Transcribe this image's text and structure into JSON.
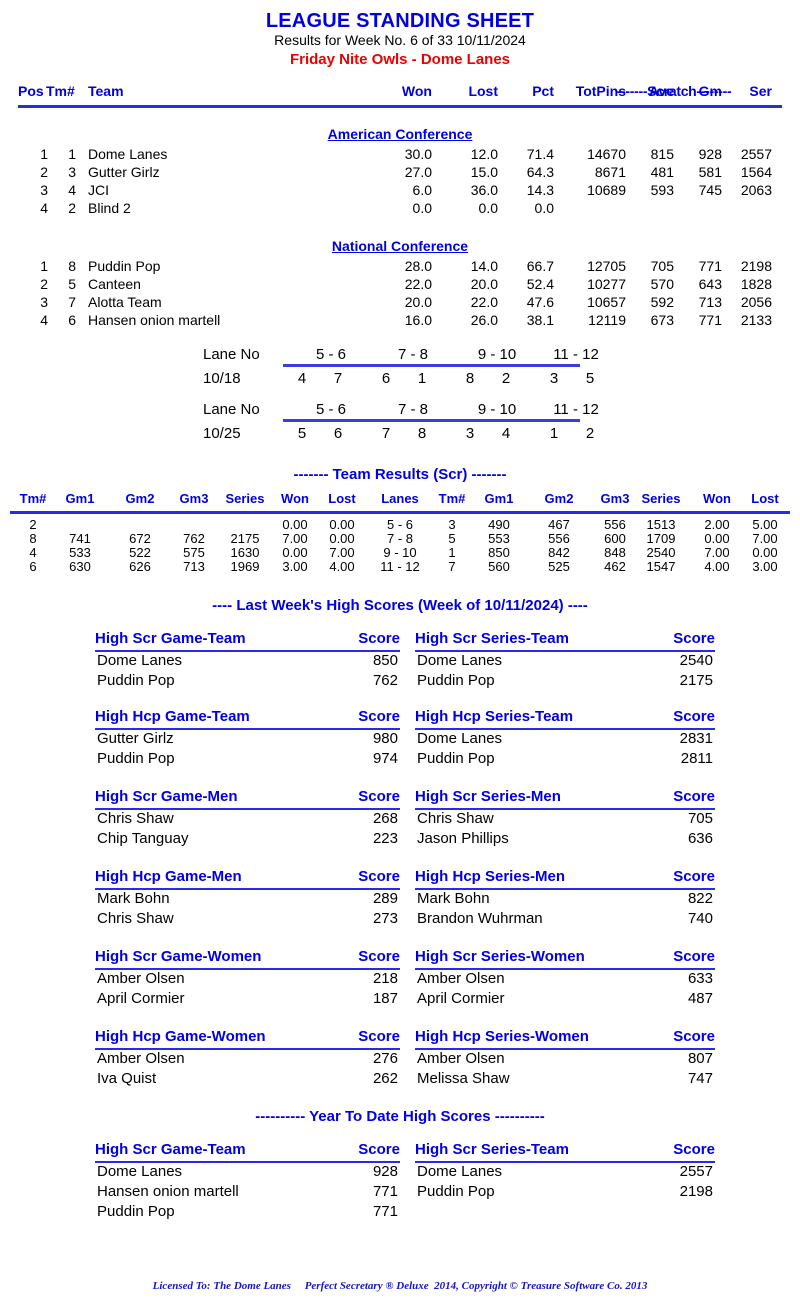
{
  "header": {
    "title": "LEAGUE STANDING SHEET",
    "subtitle": "Results for Week No. 6 of 33    10/11/2024",
    "league": "Friday Nite Owls - Dome Lanes"
  },
  "standings": {
    "scratch_label": "-------Scratch--------",
    "columns": [
      "Pos",
      "Tm#",
      "Team",
      "Won",
      "Lost",
      "Pct",
      "TotPins",
      "Ave",
      "Gm",
      "Ser"
    ],
    "conferences": [
      {
        "name": "American Conference",
        "rows": [
          {
            "pos": "1",
            "tm": "1",
            "team": "Dome Lanes",
            "won": "30.0",
            "lost": "12.0",
            "pct": "71.4",
            "totpins": "14670",
            "ave": "815",
            "gm": "928",
            "ser": "2557"
          },
          {
            "pos": "2",
            "tm": "3",
            "team": "Gutter Girlz",
            "won": "27.0",
            "lost": "15.0",
            "pct": "64.3",
            "totpins": "8671",
            "ave": "481",
            "gm": "581",
            "ser": "1564"
          },
          {
            "pos": "3",
            "tm": "4",
            "team": "JCI",
            "won": "6.0",
            "lost": "36.0",
            "pct": "14.3",
            "totpins": "10689",
            "ave": "593",
            "gm": "745",
            "ser": "2063"
          },
          {
            "pos": "4",
            "tm": "2",
            "team": "Blind 2",
            "won": "0.0",
            "lost": "0.0",
            "pct": "0.0",
            "totpins": "",
            "ave": "",
            "gm": "",
            "ser": ""
          }
        ]
      },
      {
        "name": "National Conference",
        "rows": [
          {
            "pos": "1",
            "tm": "8",
            "team": "Puddin Pop",
            "won": "28.0",
            "lost": "14.0",
            "pct": "66.7",
            "totpins": "12705",
            "ave": "705",
            "gm": "771",
            "ser": "2198"
          },
          {
            "pos": "2",
            "tm": "5",
            "team": "Canteen",
            "won": "22.0",
            "lost": "20.0",
            "pct": "52.4",
            "totpins": "10277",
            "ave": "570",
            "gm": "643",
            "ser": "1828"
          },
          {
            "pos": "3",
            "tm": "7",
            "team": "Alotta Team",
            "won": "20.0",
            "lost": "22.0",
            "pct": "47.6",
            "totpins": "10657",
            "ave": "592",
            "gm": "713",
            "ser": "2056"
          },
          {
            "pos": "4",
            "tm": "6",
            "team": "Hansen onion martell",
            "won": "16.0",
            "lost": "26.0",
            "pct": "38.1",
            "totpins": "12119",
            "ave": "673",
            "gm": "771",
            "ser": "2133"
          }
        ]
      }
    ]
  },
  "lane_schedules": [
    {
      "label": "Lane No",
      "date": "10/18",
      "lanes": [
        "5 -  6",
        "7 -  8",
        "9 - 10",
        "11 - 12"
      ],
      "teams": [
        "4",
        "7",
        "6",
        "1",
        "8",
        "2",
        "3",
        "5"
      ]
    },
    {
      "label": "Lane No",
      "date": "10/25",
      "lanes": [
        "5 -  6",
        "7 -  8",
        "9 - 10",
        "11 - 12"
      ],
      "teams": [
        "5",
        "6",
        "7",
        "8",
        "3",
        "4",
        "1",
        "2"
      ]
    }
  ],
  "team_results": {
    "title": "------- Team Results (Scr) -------",
    "columns": [
      "Tm#",
      "Gm1",
      "Gm2",
      "Gm3",
      "Series",
      "Won",
      "Lost",
      "Lanes",
      "Tm#",
      "Gm1",
      "Gm2",
      "Gm3",
      "Series",
      "Won",
      "Lost"
    ],
    "rows": [
      {
        "a_tm": "2",
        "a_gm1": "",
        "a_gm2": "",
        "a_gm3": "",
        "a_series": "",
        "a_won": "0.00",
        "a_lost": "0.00",
        "lanes": "5  -  6",
        "b_tm": "3",
        "b_gm1": "490",
        "b_gm2": "467",
        "b_gm3": "556",
        "b_series": "1513",
        "b_won": "2.00",
        "b_lost": "5.00"
      },
      {
        "a_tm": "8",
        "a_gm1": "741",
        "a_gm2": "672",
        "a_gm3": "762",
        "a_series": "2175",
        "a_won": "7.00",
        "a_lost": "0.00",
        "lanes": "7  -  8",
        "b_tm": "5",
        "b_gm1": "553",
        "b_gm2": "556",
        "b_gm3": "600",
        "b_series": "1709",
        "b_won": "0.00",
        "b_lost": "7.00"
      },
      {
        "a_tm": "4",
        "a_gm1": "533",
        "a_gm2": "522",
        "a_gm3": "575",
        "a_series": "1630",
        "a_won": "0.00",
        "a_lost": "7.00",
        "lanes": "9  - 10",
        "b_tm": "1",
        "b_gm1": "850",
        "b_gm2": "842",
        "b_gm3": "848",
        "b_series": "2540",
        "b_won": "7.00",
        "b_lost": "0.00"
      },
      {
        "a_tm": "6",
        "a_gm1": "630",
        "a_gm2": "626",
        "a_gm3": "713",
        "a_series": "1969",
        "a_won": "3.00",
        "a_lost": "4.00",
        "lanes": "11 - 12",
        "b_tm": "7",
        "b_gm1": "560",
        "b_gm2": "525",
        "b_gm3": "462",
        "b_series": "1547",
        "b_won": "4.00",
        "b_lost": "3.00"
      }
    ]
  },
  "last_week": {
    "heading": "----  Last Week's High Scores   (Week of 10/11/2024)  ----",
    "score_header": "Score",
    "blocks": [
      {
        "left": {
          "category": "High Scr Game-Team",
          "rows": [
            {
              "name": "Dome Lanes",
              "score": "850"
            },
            {
              "name": "Puddin Pop",
              "score": "762"
            }
          ]
        },
        "right": {
          "category": "High Scr Series-Team",
          "rows": [
            {
              "name": "Dome Lanes",
              "score": "2540"
            },
            {
              "name": "Puddin Pop",
              "score": "2175"
            }
          ]
        }
      },
      {
        "left": {
          "category": "High Hcp Game-Team",
          "rows": [
            {
              "name": "Gutter Girlz",
              "score": "980"
            },
            {
              "name": "Puddin Pop",
              "score": "974"
            }
          ]
        },
        "right": {
          "category": "High Hcp Series-Team",
          "rows": [
            {
              "name": "Dome Lanes",
              "score": "2831"
            },
            {
              "name": "Puddin Pop",
              "score": "2811"
            }
          ]
        }
      },
      {
        "left": {
          "category": "High Scr Game-Men",
          "rows": [
            {
              "name": "Chris Shaw",
              "score": "268"
            },
            {
              "name": "Chip Tanguay",
              "score": "223"
            }
          ]
        },
        "right": {
          "category": "High Scr Series-Men",
          "rows": [
            {
              "name": "Chris Shaw",
              "score": "705"
            },
            {
              "name": "Jason Phillips",
              "score": "636"
            }
          ]
        }
      },
      {
        "left": {
          "category": "High Hcp Game-Men",
          "rows": [
            {
              "name": "Mark Bohn",
              "score": "289"
            },
            {
              "name": "Chris Shaw",
              "score": "273"
            }
          ]
        },
        "right": {
          "category": "High Hcp Series-Men",
          "rows": [
            {
              "name": "Mark Bohn",
              "score": "822"
            },
            {
              "name": "Brandon Wuhrman",
              "score": "740"
            }
          ]
        }
      },
      {
        "left": {
          "category": "High Scr Game-Women",
          "rows": [
            {
              "name": "Amber Olsen",
              "score": "218"
            },
            {
              "name": "April Cormier",
              "score": "187"
            }
          ]
        },
        "right": {
          "category": "High Scr Series-Women",
          "rows": [
            {
              "name": "Amber Olsen",
              "score": "633"
            },
            {
              "name": "April Cormier",
              "score": "487"
            }
          ]
        }
      },
      {
        "left": {
          "category": "High Hcp Game-Women",
          "rows": [
            {
              "name": "Amber Olsen",
              "score": "276"
            },
            {
              "name": "Iva Quist",
              "score": "262"
            }
          ]
        },
        "right": {
          "category": "High Hcp Series-Women",
          "rows": [
            {
              "name": "Amber Olsen",
              "score": "807"
            },
            {
              "name": "Melissa Shaw",
              "score": "747"
            }
          ]
        }
      }
    ]
  },
  "year_to_date": {
    "heading": "---------- Year To Date High Scores ----------",
    "score_header": "Score",
    "blocks": [
      {
        "left": {
          "category": "High Scr Game-Team",
          "rows": [
            {
              "name": "Dome Lanes",
              "score": "928"
            },
            {
              "name": "Hansen onion martell",
              "score": "771"
            },
            {
              "name": "Puddin Pop",
              "score": "771"
            }
          ]
        },
        "right": {
          "category": "High Scr Series-Team",
          "rows": [
            {
              "name": "Dome Lanes",
              "score": "2557"
            },
            {
              "name": "Puddin Pop",
              "score": "2198"
            }
          ]
        }
      }
    ]
  },
  "footer": {
    "text": "Licensed To: The Dome Lanes     Perfect Secretary ® Deluxe  2014, Copyright © Treasure Software Co. 2013"
  },
  "colors": {
    "accent_blue": "#0000e0",
    "rule_blue": "#2a2ae6",
    "league_red": "#ee0000"
  }
}
